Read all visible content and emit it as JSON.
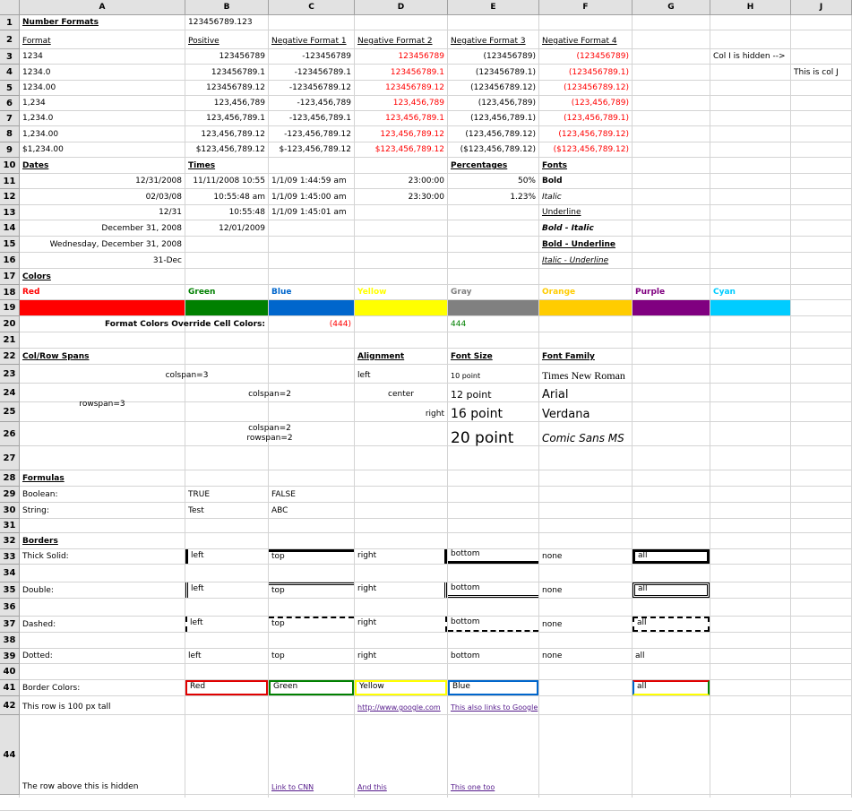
{
  "columns": [
    "A",
    "B",
    "C",
    "D",
    "E",
    "F",
    "G",
    "H",
    "J"
  ],
  "rows": [
    "1",
    "2",
    "3",
    "4",
    "5",
    "6",
    "7",
    "8",
    "9",
    "10",
    "11",
    "12",
    "13",
    "14",
    "15",
    "16",
    "17",
    "18",
    "19",
    "20",
    "21",
    "22",
    "23",
    "24",
    "25",
    "26",
    "27",
    "28",
    "29",
    "30",
    "31",
    "32",
    "33",
    "34",
    "35",
    "36",
    "37",
    "38",
    "39",
    "40",
    "41",
    "42",
    "44"
  ],
  "colors": {
    "red": "#ff0000",
    "green": "#008000",
    "blue": "#0066cc",
    "yellow": "#ffff00",
    "gray": "#808080",
    "orange": "#ffcc00",
    "purple": "#800080",
    "cyan": "#00ccff"
  },
  "cells": [
    {
      "id": "a1",
      "t": "Number Formats",
      "s": "b u"
    },
    {
      "id": "b1",
      "t": "123456789.123",
      "s": ""
    },
    {
      "id": "a2",
      "t": "Format",
      "s": "u"
    },
    {
      "id": "b2",
      "t": "Positive",
      "s": "u"
    },
    {
      "id": "c2",
      "t": "Negative Format 1",
      "s": "u"
    },
    {
      "id": "d2",
      "t": "Negative Format 2",
      "s": "u"
    },
    {
      "id": "e2",
      "t": "Negative Format 3",
      "s": "u"
    },
    {
      "id": "f2",
      "t": "Negative Format 4",
      "s": "u"
    },
    {
      "id": "a3",
      "t": "1234",
      "s": ""
    },
    {
      "id": "b3",
      "t": "123456789",
      "s": "r"
    },
    {
      "id": "c3",
      "t": "-123456789",
      "s": "r"
    },
    {
      "id": "d3",
      "t": "123456789",
      "s": "r red"
    },
    {
      "id": "e3",
      "t": "(123456789)",
      "s": "r"
    },
    {
      "id": "f3",
      "t": "(123456789)",
      "s": "r red"
    },
    {
      "id": "h3",
      "t": "Col I is hidden -->",
      "s": ""
    },
    {
      "id": "a4",
      "t": "1234.0",
      "s": ""
    },
    {
      "id": "b4",
      "t": "123456789.1",
      "s": "r"
    },
    {
      "id": "c4",
      "t": "-123456789.1",
      "s": "r"
    },
    {
      "id": "d4",
      "t": "123456789.1",
      "s": "r red"
    },
    {
      "id": "e4",
      "t": "(123456789.1)",
      "s": "r"
    },
    {
      "id": "f4",
      "t": "(123456789.1)",
      "s": "r red"
    },
    {
      "id": "j4",
      "t": "This is col J",
      "s": ""
    },
    {
      "id": "a5",
      "t": "1234.00",
      "s": ""
    },
    {
      "id": "b5",
      "t": "123456789.12",
      "s": "r"
    },
    {
      "id": "c5",
      "t": "-123456789.12",
      "s": "r"
    },
    {
      "id": "d5",
      "t": "123456789.12",
      "s": "r red"
    },
    {
      "id": "e5",
      "t": "(123456789.12)",
      "s": "r"
    },
    {
      "id": "f5",
      "t": "(123456789.12)",
      "s": "r red"
    },
    {
      "id": "a6",
      "t": "1,234",
      "s": ""
    },
    {
      "id": "b6",
      "t": "123,456,789",
      "s": "r"
    },
    {
      "id": "c6",
      "t": "-123,456,789",
      "s": "r"
    },
    {
      "id": "d6",
      "t": "123,456,789",
      "s": "r red"
    },
    {
      "id": "e6",
      "t": "(123,456,789)",
      "s": "r"
    },
    {
      "id": "f6",
      "t": "(123,456,789)",
      "s": "r red"
    },
    {
      "id": "a7",
      "t": "1,234.0",
      "s": ""
    },
    {
      "id": "b7",
      "t": "123,456,789.1",
      "s": "r"
    },
    {
      "id": "c7",
      "t": "-123,456,789.1",
      "s": "r"
    },
    {
      "id": "d7",
      "t": "123,456,789.1",
      "s": "r red"
    },
    {
      "id": "e7",
      "t": "(123,456,789.1)",
      "s": "r"
    },
    {
      "id": "f7",
      "t": "(123,456,789.1)",
      "s": "r red"
    },
    {
      "id": "a8",
      "t": "1,234.00",
      "s": ""
    },
    {
      "id": "b8",
      "t": "123,456,789.12",
      "s": "r"
    },
    {
      "id": "c8",
      "t": "-123,456,789.12",
      "s": "r"
    },
    {
      "id": "d8",
      "t": "123,456,789.12",
      "s": "r red"
    },
    {
      "id": "e8",
      "t": "(123,456,789.12)",
      "s": "r"
    },
    {
      "id": "f8",
      "t": "(123,456,789.12)",
      "s": "r red"
    },
    {
      "id": "a9",
      "t": "$1,234.00",
      "s": ""
    },
    {
      "id": "b9",
      "t": "$123,456,789.12",
      "s": "r"
    },
    {
      "id": "c9",
      "t": "$-123,456,789.12",
      "s": "r"
    },
    {
      "id": "d9",
      "t": "$123,456,789.12",
      "s": "r red"
    },
    {
      "id": "e9",
      "t": "($123,456,789.12)",
      "s": "r"
    },
    {
      "id": "f9",
      "t": "($123,456,789.12)",
      "s": "r red"
    },
    {
      "id": "a10",
      "t": "Dates",
      "s": "b u"
    },
    {
      "id": "b10",
      "t": "Times",
      "s": "b u"
    },
    {
      "id": "e10",
      "t": "Percentages",
      "s": "b u"
    },
    {
      "id": "f10",
      "t": "Fonts",
      "s": "b u"
    },
    {
      "id": "a11",
      "t": "12/31/2008",
      "s": "r"
    },
    {
      "id": "b11",
      "t": "11/11/2008 10:55",
      "s": "r"
    },
    {
      "id": "c11",
      "t": "1/1/09 1:44:59 am",
      "s": ""
    },
    {
      "id": "d11",
      "t": "23:00:00",
      "s": "r"
    },
    {
      "id": "e11",
      "t": "50%",
      "s": "r"
    },
    {
      "id": "f11",
      "t": "Bold",
      "s": "b"
    },
    {
      "id": "a12",
      "t": "02/03/08",
      "s": "r"
    },
    {
      "id": "b12",
      "t": "10:55:48 am",
      "s": "r"
    },
    {
      "id": "c12",
      "t": "1/1/09 1:45:00 am",
      "s": ""
    },
    {
      "id": "d12",
      "t": "23:30:00",
      "s": "r"
    },
    {
      "id": "e12",
      "t": "1.23%",
      "s": "r"
    },
    {
      "id": "f12",
      "t": "Italic",
      "s": "i"
    },
    {
      "id": "a13",
      "t": "12/31",
      "s": "r"
    },
    {
      "id": "b13",
      "t": "10:55:48",
      "s": "r"
    },
    {
      "id": "c13",
      "t": "1/1/09 1:45:01 am",
      "s": ""
    },
    {
      "id": "f13",
      "t": "Underline",
      "s": "u"
    },
    {
      "id": "a14",
      "t": "December 31, 2008",
      "s": "r"
    },
    {
      "id": "b14",
      "t": "12/01/2009",
      "s": "r"
    },
    {
      "id": "f14",
      "t": "Bold - Italic",
      "s": "b i"
    },
    {
      "id": "a15",
      "t": "Wednesday, December 31, 2008",
      "s": "r"
    },
    {
      "id": "f15",
      "t": "Bold - Underline",
      "s": "b u"
    },
    {
      "id": "a16",
      "t": "31-Dec",
      "s": "r"
    },
    {
      "id": "f16",
      "t": "Italic - Underline",
      "s": "i u"
    },
    {
      "id": "a17",
      "t": "Colors",
      "s": "b u"
    },
    {
      "id": "a18",
      "t": "Red",
      "s": "b",
      "color": "#ff0000"
    },
    {
      "id": "b18",
      "t": "Green",
      "s": "b",
      "color": "#008000"
    },
    {
      "id": "c18",
      "t": "Blue",
      "s": "b",
      "color": "#0066cc"
    },
    {
      "id": "d18",
      "t": "Yellow",
      "s": "b",
      "color": "#ffff00"
    },
    {
      "id": "e18",
      "t": "Gray",
      "s": "b",
      "color": "#808080"
    },
    {
      "id": "f18",
      "t": "Orange",
      "s": "b",
      "color": "#ffcc00"
    },
    {
      "id": "g18",
      "t": "Purple",
      "s": "b",
      "color": "#800080"
    },
    {
      "id": "h18",
      "t": "Cyan",
      "s": "b",
      "color": "#00ccff"
    },
    {
      "id": "a20",
      "t": "Format Colors Override Cell Colors:",
      "s": "b r"
    },
    {
      "id": "c20",
      "t": "(444)",
      "s": "r red"
    },
    {
      "id": "e20",
      "t": "444",
      "s": "grn"
    },
    {
      "id": "a22",
      "t": "Col/Row Spans",
      "s": "b u"
    },
    {
      "id": "d22",
      "t": "Alignment",
      "s": "b u"
    },
    {
      "id": "e22",
      "t": "Font Size",
      "s": "b u"
    },
    {
      "id": "f22",
      "t": "Font Family",
      "s": "b u"
    },
    {
      "id": "abc23",
      "t": "colspan=3",
      "s": "c"
    },
    {
      "id": "d23",
      "t": "left",
      "s": ""
    },
    {
      "id": "e23",
      "t": "10 point",
      "s": "",
      "fs": "8px"
    },
    {
      "id": "f23",
      "t": "Times New Roman",
      "s": "",
      "ff": "\"Liberation Serif\", serif",
      "fs": "12px"
    },
    {
      "id": "bc24",
      "t": "colspan=2",
      "s": "c"
    },
    {
      "id": "d24",
      "t": "center",
      "s": "c"
    },
    {
      "id": "e24",
      "t": "12 point",
      "s": "",
      "fs": "11px"
    },
    {
      "id": "f24",
      "t": "Arial",
      "s": "",
      "fs": "13px"
    },
    {
      "id": "d25",
      "t": "right",
      "s": "r"
    },
    {
      "id": "e25",
      "t": "16 point",
      "s": "",
      "fs": "14px"
    },
    {
      "id": "f25",
      "t": "Verdana",
      "s": "",
      "fs": "13px"
    },
    {
      "id": "a26",
      "t": "rowspan=3",
      "s": "c"
    },
    {
      "id": "bc26",
      "t": "colspan=2\nrowspan=2",
      "s": "c"
    },
    {
      "id": "e26",
      "t": "20 point",
      "s": "",
      "fs": "17px"
    },
    {
      "id": "f26",
      "t": "Comic Sans MS",
      "s": "i",
      "fs": "12px"
    },
    {
      "id": "a28",
      "t": "Formulas",
      "s": "b u"
    },
    {
      "id": "a29",
      "t": "Boolean:",
      "s": ""
    },
    {
      "id": "b29",
      "t": "TRUE",
      "s": ""
    },
    {
      "id": "c29",
      "t": "FALSE",
      "s": ""
    },
    {
      "id": "a30",
      "t": "String:",
      "s": ""
    },
    {
      "id": "b30",
      "t": "Test",
      "s": ""
    },
    {
      "id": "c30",
      "t": "ABC",
      "s": ""
    },
    {
      "id": "a32",
      "t": "Borders",
      "s": "b u"
    },
    {
      "id": "a33",
      "t": "Thick Solid:",
      "s": ""
    },
    {
      "id": "b33",
      "t": "left",
      "s": ""
    },
    {
      "id": "c33",
      "t": "top",
      "s": ""
    },
    {
      "id": "d33",
      "t": "right",
      "s": ""
    },
    {
      "id": "e33",
      "t": "bottom",
      "s": ""
    },
    {
      "id": "f33",
      "t": "none",
      "s": ""
    },
    {
      "id": "g33",
      "t": "all",
      "s": ""
    },
    {
      "id": "a35",
      "t": "Double:",
      "s": ""
    },
    {
      "id": "b35",
      "t": "left",
      "s": ""
    },
    {
      "id": "c35",
      "t": "top",
      "s": ""
    },
    {
      "id": "d35",
      "t": "right",
      "s": ""
    },
    {
      "id": "e35",
      "t": "bottom",
      "s": ""
    },
    {
      "id": "f35",
      "t": "none",
      "s": ""
    },
    {
      "id": "g35",
      "t": "all",
      "s": ""
    },
    {
      "id": "a37",
      "t": "Dashed:",
      "s": ""
    },
    {
      "id": "b37",
      "t": "left",
      "s": ""
    },
    {
      "id": "c37",
      "t": "top",
      "s": ""
    },
    {
      "id": "d37",
      "t": "right",
      "s": ""
    },
    {
      "id": "e37",
      "t": "bottom",
      "s": ""
    },
    {
      "id": "f37",
      "t": "none",
      "s": ""
    },
    {
      "id": "g37",
      "t": "all",
      "s": ""
    },
    {
      "id": "a39",
      "t": "Dotted:",
      "s": ""
    },
    {
      "id": "b39",
      "t": "left",
      "s": ""
    },
    {
      "id": "c39",
      "t": "top",
      "s": ""
    },
    {
      "id": "d39",
      "t": "right",
      "s": ""
    },
    {
      "id": "e39",
      "t": "bottom",
      "s": ""
    },
    {
      "id": "f39",
      "t": "none",
      "s": ""
    },
    {
      "id": "g39",
      "t": "all",
      "s": ""
    },
    {
      "id": "a41",
      "t": "Border Colors:",
      "s": ""
    },
    {
      "id": "b41",
      "t": "Red",
      "s": ""
    },
    {
      "id": "c41",
      "t": "Green",
      "s": ""
    },
    {
      "id": "d41",
      "t": "Yellow",
      "s": ""
    },
    {
      "id": "e41",
      "t": "Blue",
      "s": ""
    },
    {
      "id": "g41",
      "t": "all",
      "s": ""
    },
    {
      "id": "a42",
      "t": "This row is 100 px tall",
      "s": ""
    },
    {
      "id": "d42",
      "t": "http://www.google.com",
      "s": "lnk",
      "link": true
    },
    {
      "id": "e42",
      "t": "This also links to Google",
      "s": "lnk",
      "link": true
    },
    {
      "id": "a44",
      "t": "The row above this is hidden",
      "s": ""
    },
    {
      "id": "c44",
      "t": "Link to CNN",
      "s": "lnk",
      "link": true
    },
    {
      "id": "d44",
      "t": "And this",
      "s": "lnk",
      "link": true
    },
    {
      "id": "e44",
      "t": "This one too",
      "s": "lnk",
      "link": true
    }
  ]
}
